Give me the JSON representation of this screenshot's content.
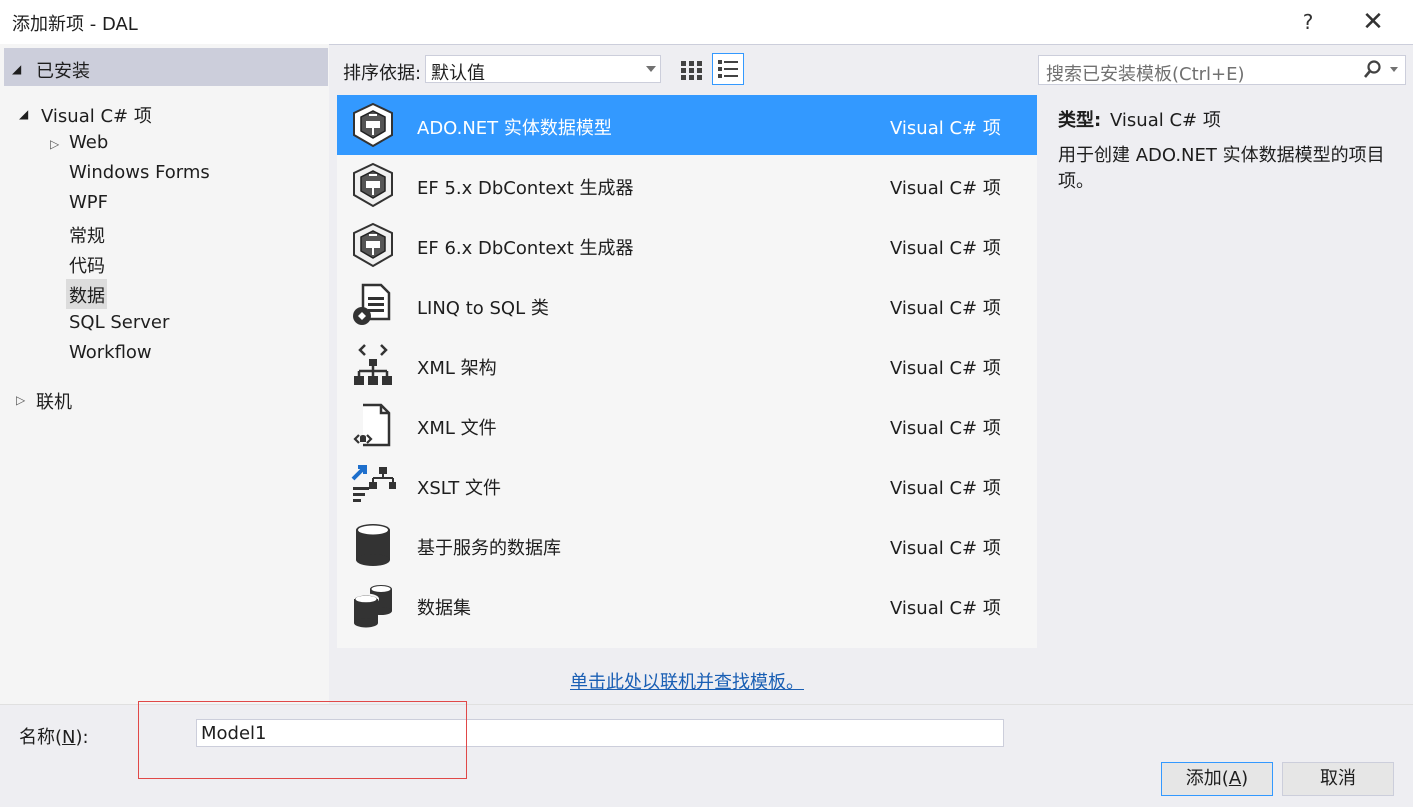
{
  "window": {
    "title": "添加新项 - DAL",
    "help": "?",
    "close": "✕"
  },
  "tree": {
    "installed": "已安装",
    "visual_csharp": "Visual C# 项",
    "children": [
      "Web",
      "Windows Forms",
      "WPF",
      "常规",
      "代码",
      "数据",
      "SQL Server",
      "Workflow"
    ],
    "selected": "数据",
    "online": "联机"
  },
  "toolbar": {
    "sort_label": "排序依据:",
    "sort_value": "默认值"
  },
  "search": {
    "placeholder": "搜索已安装模板(Ctrl+E)"
  },
  "templates": [
    {
      "name": "ADO.NET 实体数据模型",
      "kind": "Visual C# 项",
      "icon": "entity-model-icon",
      "selected": true
    },
    {
      "name": "EF 5.x DbContext 生成器",
      "kind": "Visual C# 项",
      "icon": "entity-model-icon"
    },
    {
      "name": "EF 6.x DbContext 生成器",
      "kind": "Visual C# 项",
      "icon": "entity-model-icon"
    },
    {
      "name": "LINQ to SQL 类",
      "kind": "Visual C# 项",
      "icon": "linq-to-sql-icon"
    },
    {
      "name": "XML 架构",
      "kind": "Visual C# 项",
      "icon": "xml-schema-icon"
    },
    {
      "name": "XML 文件",
      "kind": "Visual C# 项",
      "icon": "xml-file-icon"
    },
    {
      "name": "XSLT 文件",
      "kind": "Visual C# 项",
      "icon": "xslt-file-icon"
    },
    {
      "name": "基于服务的数据库",
      "kind": "Visual C# 项",
      "icon": "database-icon"
    },
    {
      "name": "数据集",
      "kind": "Visual C# 项",
      "icon": "dataset-icon"
    }
  ],
  "online_link": "单击此处以联机并查找模板。",
  "details": {
    "type_label": "类型:",
    "type_value": "Visual C# 项",
    "description": "用于创建 ADO.NET 实体数据模型的项目项。"
  },
  "name_field": {
    "label_prefix": "名称(",
    "label_key": "N",
    "label_suffix": "):",
    "value": "Model1"
  },
  "buttons": {
    "add_prefix": "添加(",
    "add_key": "A",
    "add_suffix": ")",
    "cancel": "取消"
  },
  "colors": {
    "accent": "#3399ff",
    "highlight_box": "#e04848"
  }
}
